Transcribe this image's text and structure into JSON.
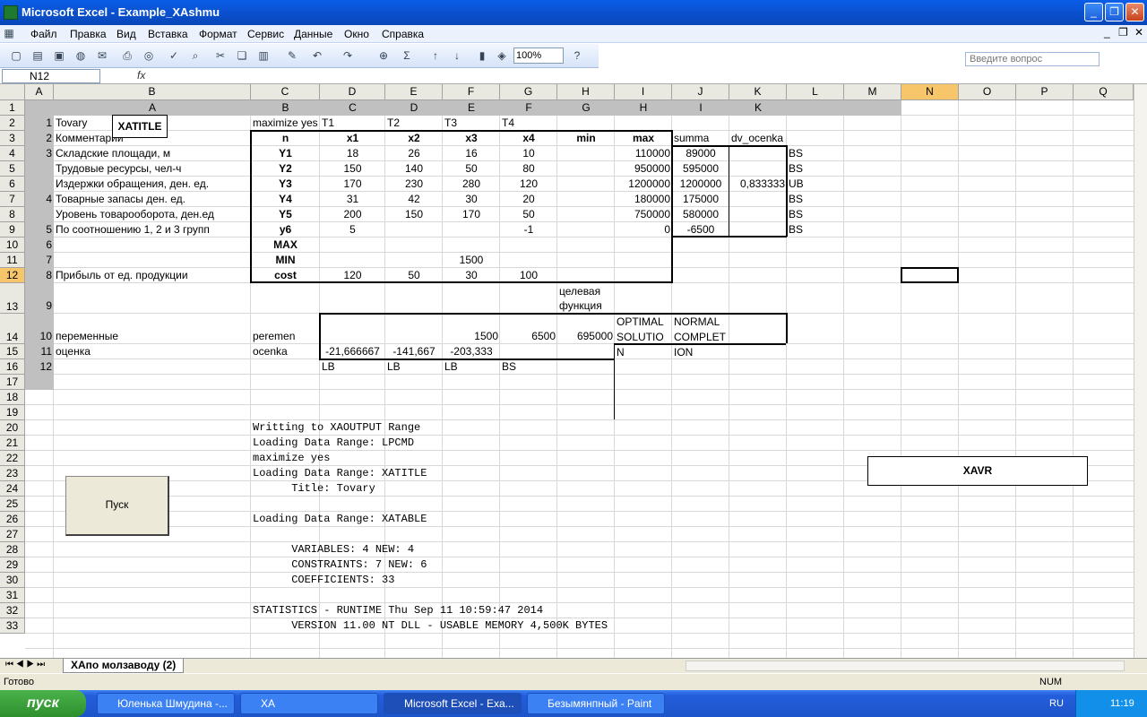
{
  "window": {
    "title": "Microsoft Excel - Example_XAshmu",
    "app_icon": "excel-icon"
  },
  "menu": [
    "Файл",
    "Правка",
    "Вид",
    "Вставка",
    "Формат",
    "Сервис",
    "Данные",
    "Окно",
    "Справка"
  ],
  "ask": {
    "placeholder": "Введите вопрос"
  },
  "toolbar": {
    "zoom": "100%"
  },
  "formula_bar": {
    "namebox": "N12",
    "fx": "fx",
    "content": ""
  },
  "columns": [
    "A",
    "B",
    "C",
    "D",
    "E",
    "F",
    "G",
    "H",
    "I",
    "J",
    "K",
    "L",
    "M",
    "N",
    "O",
    "P",
    "Q"
  ],
  "rows": [
    "1",
    "2",
    "3",
    "4",
    "5",
    "6",
    "7",
    "8",
    "9",
    "10",
    "11",
    "12",
    "13",
    "14",
    "15",
    "16",
    "17",
    "18",
    "19",
    "20",
    "21",
    "22",
    "23",
    "24",
    "25",
    "26",
    "27",
    "28",
    "29",
    "30",
    "31",
    "32",
    "33"
  ],
  "row1_labels": {
    "B": "A",
    "C": "B",
    "D": "C",
    "E": "D",
    "F": "E",
    "G": "F",
    "H": "G",
    "I": "H",
    "J": "I",
    "K": "K"
  },
  "colA": {
    "r2": "1",
    "r3": "2",
    "r4": "3",
    "r7": "4",
    "r9": "5",
    "r10": "6",
    "r11": "7",
    "r12": "8",
    "r13": "9",
    "r14": "10",
    "r15": "11",
    "r16": "12"
  },
  "colB": {
    "r2": "Tovary",
    "r3": "Комментарии",
    "r4": "Складские площади, м",
    "r5": "Трудовые ресурсы, чел-ч",
    "r6": "Издержки обращения, ден. ед.",
    "r7": "Товарные запасы ден. ед.",
    "r8": "Уровень товарооборота, ден.ед",
    "r9": "По соотношению 1, 2 и 3 групп",
    "r12": "Прибыль от ед. продукции",
    "r14": "переменные",
    "r15": "оценка"
  },
  "colC": {
    "r2": "maximize yes",
    "r3": "n",
    "r4": "Y1",
    "r5": "Y2",
    "r6": "Y3",
    "r7": "Y4",
    "r8": "Y5",
    "r9": "y6",
    "r10": "MAX",
    "r11": "MIN",
    "r12": "cost",
    "r14": "peremen",
    "r15": "ocenka"
  },
  "header_row2": {
    "D": "T1",
    "E": "T2",
    "F": "T3",
    "G": "T4"
  },
  "header_row3": {
    "D": "x1",
    "E": "x2",
    "F": "x3",
    "G": "x4",
    "H": "min",
    "I": "max",
    "J": "summa",
    "K": "dv_ocenka"
  },
  "table": [
    {
      "D": "18",
      "E": "26",
      "F": "16",
      "G": "10",
      "I": "110000",
      "J": "89000",
      "L": "BS"
    },
    {
      "D": "150",
      "E": "140",
      "F": "50",
      "G": "80",
      "I": "950000",
      "J": "595000",
      "L": "BS"
    },
    {
      "D": "170",
      "E": "230",
      "F": "280",
      "G": "120",
      "I": "1200000",
      "J": "1200000",
      "K": "0,833333",
      "L": "UB"
    },
    {
      "D": "31",
      "E": "42",
      "F": "30",
      "G": "20",
      "I": "180000",
      "J": "175000",
      "L": "BS"
    },
    {
      "D": "200",
      "E": "150",
      "F": "170",
      "G": "50",
      "I": "750000",
      "J": "580000",
      "L": "BS"
    },
    {
      "D": "5",
      "E": "",
      "F": "",
      "G": "-1",
      "I": "0",
      "J": "-6500",
      "L": "BS"
    }
  ],
  "row11": {
    "F": "1500"
  },
  "row12": {
    "D": "120",
    "E": "50",
    "F": "30",
    "G": "100"
  },
  "row13": {
    "H": "целевая функция"
  },
  "row14": {
    "F": "1500",
    "G": "6500",
    "H": "695000",
    "I": "OPTIMAL SOLUTION",
    "J": "NORMAL COMPLETION"
  },
  "row15": {
    "D": "-21,666667",
    "E": "-141,667",
    "F": "-203,333"
  },
  "row16": {
    "D": "LB",
    "E": "LB",
    "F": "LB",
    "G": "BS"
  },
  "output": {
    "r20": "Writting to XAOUTPUT Range",
    "r21": "Loading Data Range: LPCMD",
    "r22": "maximize yes",
    "r23": "Loading Data Range: XATITLE",
    "r24": "      Title: Tovary",
    "r26": "Loading Data Range: XATABLE",
    "r28": "      VARIABLES: 4 NEW: 4",
    "r29": "      CONSTRAINTS: 7 NEW: 6",
    "r30": "      COEFFICIENTS: 33",
    "r32": "STATISTICS - RUNTIME Thu Sep 11 10:59:47 2014",
    "r33": "      VERSION 11.00 NT DLL - USABLE MEMORY 4,500K BYTES"
  },
  "callouts": {
    "xatitle": "XATITLE",
    "xavr": "XAVR"
  },
  "button": {
    "label": "Пуск"
  },
  "sheet_tab": "ХАпо молзаводу (2)",
  "status": {
    "left": "Готово",
    "num": "NUM"
  },
  "taskbar": {
    "start": "пуск",
    "items": [
      "Юленька Шмудина -...",
      "XA",
      "Microsoft Excel - Exa...",
      "Безымянпный - Paint"
    ],
    "lang": "RU",
    "time": "11:19"
  }
}
